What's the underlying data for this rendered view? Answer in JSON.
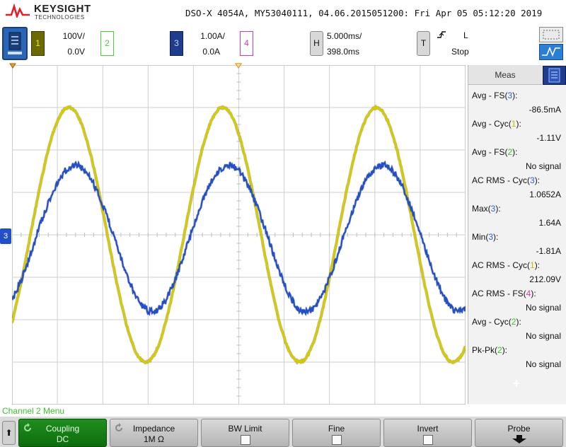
{
  "header": {
    "brand_name": "KEYSIGHT",
    "brand_sub": "TECHNOLOGIES",
    "title": "DSO-X 4054A, MY53040111, 04.06.2015051200: Fri Apr 05 05:12:20 2019"
  },
  "channels": [
    {
      "num": "1",
      "scale": "100V/",
      "offset": "0.0V",
      "color": "#d8cc00"
    },
    {
      "num": "2",
      "color": "#3fbf30"
    },
    {
      "num": "3",
      "scale": "1.00A/",
      "offset": "0.0A",
      "color": "#2350c8"
    },
    {
      "num": "4",
      "color": "#d03bb0"
    }
  ],
  "timebase": {
    "key": "H",
    "scale": "5.000ms/",
    "delay": "398.0ms"
  },
  "trigger": {
    "key": "T",
    "edge_icon": "rising-edge-icon",
    "level": "L",
    "state": "Stop"
  },
  "measurements": {
    "tab_label": "Meas",
    "items": [
      {
        "name": "Avg - FS(",
        "ch": "3",
        "close": "):",
        "value": "-86.5mA"
      },
      {
        "name": "Avg - Cyc(",
        "ch": "1",
        "close": "):",
        "value": "-1.11V"
      },
      {
        "name": "Avg - FS(",
        "ch": "2",
        "close": "):",
        "value": "No signal"
      },
      {
        "name": "AC RMS - Cyc(",
        "ch": "3",
        "close": "):",
        "value": "1.0652A"
      },
      {
        "name": "Max(",
        "ch": "3",
        "close": "):",
        "value": "1.64A"
      },
      {
        "name": "Min(",
        "ch": "3",
        "close": "):",
        "value": "-1.81A"
      },
      {
        "name": "AC RMS - Cyc(",
        "ch": "1",
        "close": "):",
        "value": "212.09V"
      },
      {
        "name": "AC RMS - FS(",
        "ch": "4",
        "close": "):",
        "value": "No signal"
      },
      {
        "name": "Avg - Cyc(",
        "ch": "2",
        "close": "):",
        "value": "No signal"
      },
      {
        "name": "Pk-Pk(",
        "ch": "2",
        "close": "):",
        "value": "No signal"
      }
    ],
    "add_symbol": "+"
  },
  "softkeys": {
    "menu_title": "Channel 2 Menu",
    "back_symbol": "⬆",
    "coupling": {
      "label": "Coupling",
      "value": "DC"
    },
    "impedance": {
      "label": "Impedance",
      "value": "1M Ω"
    },
    "bw_limit": {
      "label": "BW Limit"
    },
    "fine": {
      "label": "Fine"
    },
    "invert": {
      "label": "Invert"
    },
    "probe": {
      "label": "Probe"
    }
  },
  "waveforms": {
    "ch1": {
      "color": "#d8cc00",
      "outline": "#3a3a00",
      "peak_v": 300,
      "periods_on_screen": 2.95
    },
    "ch3": {
      "color": "#2350c8",
      "outline": "#0b1f5a",
      "peak_a": 1.64,
      "trough_a": -1.81
    },
    "ground_marker": "3"
  }
}
